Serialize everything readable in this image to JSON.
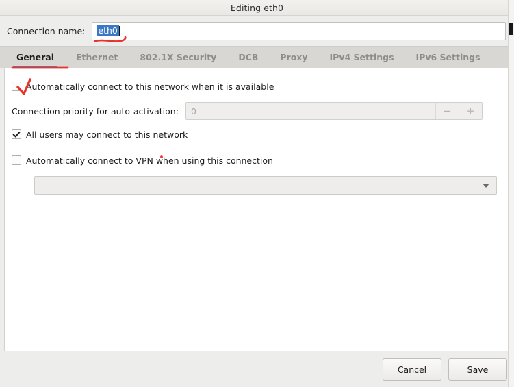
{
  "window": {
    "title": "Editing eth0"
  },
  "connection": {
    "label": "Connection name:",
    "value": "eth0",
    "placeholder": ""
  },
  "tabs": [
    {
      "label": "General",
      "active": true
    },
    {
      "label": "Ethernet",
      "active": false
    },
    {
      "label": "802.1X Security",
      "active": false
    },
    {
      "label": "DCB",
      "active": false
    },
    {
      "label": "Proxy",
      "active": false
    },
    {
      "label": "IPv4 Settings",
      "active": false
    },
    {
      "label": "IPv6 Settings",
      "active": false
    }
  ],
  "general": {
    "auto_connect": {
      "label": "Automatically connect to this network when it is available",
      "checked": false
    },
    "priority": {
      "label": "Connection priority for auto-activation:",
      "value": "0",
      "decrement_label": "−",
      "increment_label": "+"
    },
    "all_users": {
      "label": "All users may connect to this network",
      "checked": true
    },
    "auto_vpn": {
      "label": "Automatically connect to VPN when using this connection",
      "checked": false
    },
    "vpn_combo": {
      "value": "",
      "chevron": "chevron-down-icon"
    }
  },
  "footer": {
    "cancel_label": "Cancel",
    "save_label": "Save"
  },
  "annotations": {
    "ink_color": "#e8332a",
    "items": [
      {
        "name": "checkmark-over-autoconnect-checkbox",
        "kind": "check"
      },
      {
        "name": "underline-under-connection-name",
        "kind": "underline"
      },
      {
        "name": "underline-under-general-tab",
        "kind": "underline"
      },
      {
        "name": "dot-near-vpn-label",
        "kind": "dot"
      }
    ]
  },
  "theme": {
    "accent_blue": "#4a86d0",
    "selection_blue": "#3a77c6",
    "window_bg": "#ededeb",
    "tabbar_bg": "#d9d7d3",
    "content_bg": "#ffffff"
  }
}
